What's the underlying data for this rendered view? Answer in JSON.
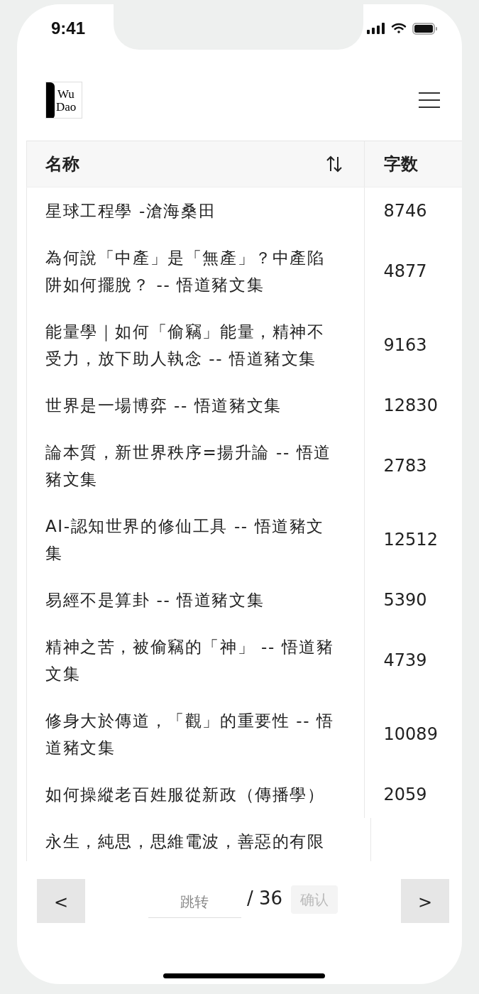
{
  "status_bar": {
    "time": "9:41"
  },
  "header": {
    "logo": {
      "line_1": "Wu",
      "line_2": "Dao"
    }
  },
  "table": {
    "columns": [
      {
        "label": "名称",
        "kind": "sortable"
      },
      {
        "label": "字数",
        "kind": "plain"
      }
    ],
    "rows": [
      {
        "name": "星球工程學 -滄海桑田",
        "count": "8746"
      },
      {
        "name": "為何說「中產」是「無產」？中產陷阱如何擺脫？ -- 悟道豬文集",
        "count": "4877"
      },
      {
        "name": "能量學｜如何「偷竊」能量，精神不受力，放下助人執念 -- 悟道豬文集",
        "count": "9163"
      },
      {
        "name": "世界是一場博弈 -- 悟道豬文集",
        "count": "12830"
      },
      {
        "name": "論本質，新世界秩序=揚升論 -- 悟道豬文集",
        "count": "2783"
      },
      {
        "name": "AI-認知世界的修仙工具 -- 悟道豬文集",
        "count": "12512"
      },
      {
        "name": "易經不是算卦 -- 悟道豬文集",
        "count": "5390"
      },
      {
        "name": "精神之苦，被偷竊的「神」 -- 悟道豬文集",
        "count": "4739"
      },
      {
        "name": "修身大於傳道，「觀」的重要性 -- 悟道豬文集",
        "count": "10089"
      },
      {
        "name": "如何操縱老百姓服從新政（傳播學）",
        "count": "2059"
      },
      {
        "name": "永生，純思，思維電波，善惡的有限"
      }
    ]
  },
  "pagination": {
    "prev": "<",
    "jump_placeholder": "跳转",
    "total": "/ 36",
    "confirm": {
      "label": "确认",
      "disabled": true
    },
    "next": ">"
  }
}
